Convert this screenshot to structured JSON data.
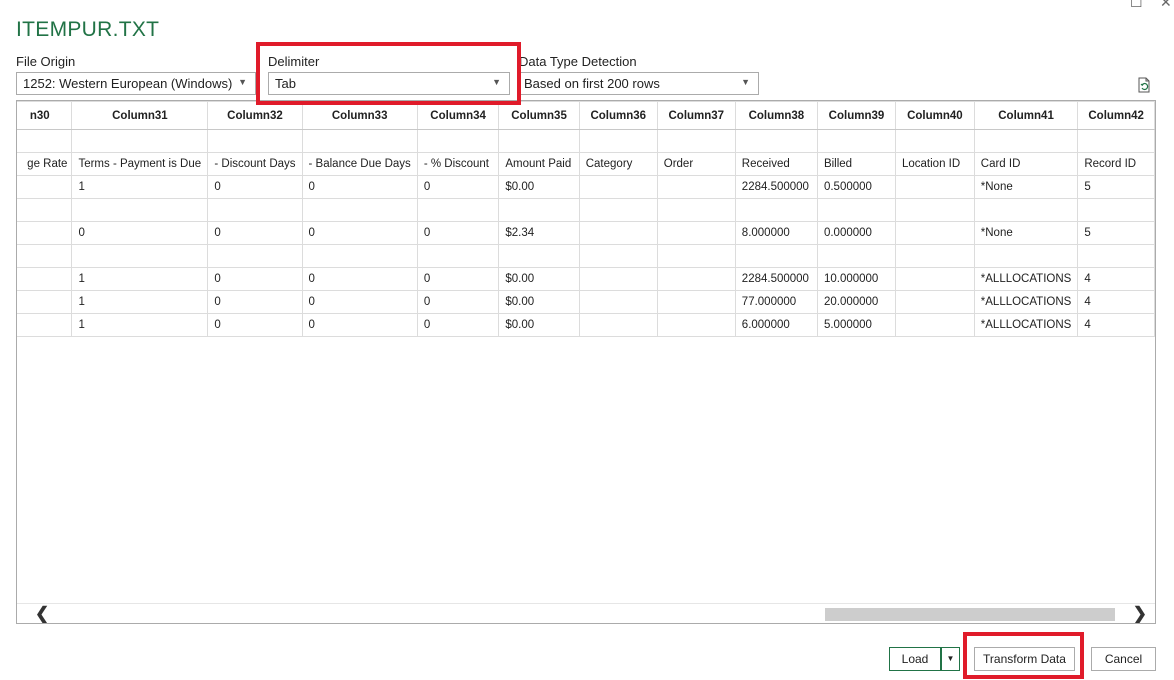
{
  "window": {
    "maximize_glyph": "☐",
    "close_glyph": "✕"
  },
  "title": "ITEMPUR.TXT",
  "file_origin": {
    "label": "File Origin",
    "value": "1252: Western European (Windows)"
  },
  "delimiter": {
    "label": "Delimiter",
    "value": "Tab"
  },
  "data_type_detection": {
    "label": "Data Type Detection",
    "value": "Based on first 200 rows"
  },
  "icons": {
    "refresh": "refresh-icon",
    "dropdown": "chevron-down-icon"
  },
  "grid": {
    "columns": [
      "n30",
      "Column31",
      "Column32",
      "Column33",
      "Column34",
      "Column35",
      "Column36",
      "Column37",
      "Column38",
      "Column39",
      "Column40",
      "Column41",
      "Column42"
    ],
    "rows": [
      [
        "",
        "",
        "",
        "",
        "",
        "",
        "",
        "",
        "",
        "",
        "",
        "",
        ""
      ],
      [
        "ge Rate",
        "Terms - Payment is Due",
        "- Discount Days",
        "- Balance Due Days",
        "- % Discount",
        "Amount Paid",
        "Category",
        "Order",
        "Received",
        "Billed",
        "Location ID",
        "Card ID",
        "Record ID"
      ],
      [
        "",
        "1",
        "0",
        "0",
        "0",
        "$0.00",
        "",
        "",
        "2284.500000",
        "0.500000",
        "",
        "*None",
        "5"
      ],
      [
        "",
        "",
        "",
        "",
        "",
        "",
        "",
        "",
        "",
        "",
        "",
        "",
        ""
      ],
      [
        "",
        "0",
        "0",
        "0",
        "0",
        "$2.34",
        "",
        "",
        "8.000000",
        "0.000000",
        "",
        "*None",
        "5"
      ],
      [
        "",
        "",
        "",
        "",
        "",
        "",
        "",
        "",
        "",
        "",
        "",
        "",
        ""
      ],
      [
        "",
        "1",
        "0",
        "0",
        "0",
        "$0.00",
        "",
        "",
        "2284.500000",
        "10.000000",
        "",
        "*ALLLOCATIONS",
        "4"
      ],
      [
        "",
        "1",
        "0",
        "0",
        "0",
        "$0.00",
        "",
        "",
        "77.000000",
        "20.000000",
        "",
        "*ALLLOCATIONS",
        "4"
      ],
      [
        "",
        "1",
        "0",
        "0",
        "0",
        "$0.00",
        "",
        "",
        "6.000000",
        "5.000000",
        "",
        "*ALLLOCATIONS",
        "4"
      ]
    ]
  },
  "scroll": {
    "left": "❮",
    "right": "❯"
  },
  "buttons": {
    "load": "Load",
    "load_split": "▼",
    "transform": "Transform Data",
    "cancel": "Cancel"
  },
  "highlight_color": "#e01b2a",
  "accent_color": "#217346"
}
